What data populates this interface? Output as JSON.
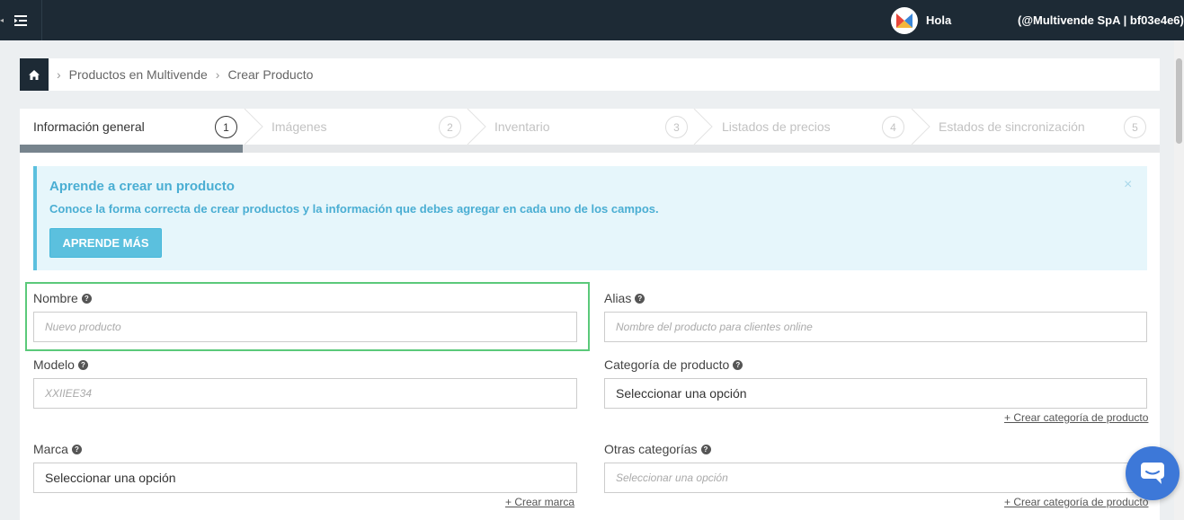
{
  "topbar": {
    "greeting": "Hola",
    "account": "(@Multivende SpA | bf03e4e6)"
  },
  "breadcrumb": {
    "items": [
      "Productos en Multivende",
      "Crear Producto"
    ]
  },
  "steps": [
    {
      "label": "Información general",
      "number": "1"
    },
    {
      "label": "Imágenes",
      "number": "2"
    },
    {
      "label": "Inventario",
      "number": "3"
    },
    {
      "label": "Listados de precios",
      "number": "4"
    },
    {
      "label": "Estados de sincronización",
      "number": "5"
    }
  ],
  "alert": {
    "title": "Aprende a crear un producto",
    "text": "Conoce la forma correcta de crear productos y la información que debes agregar en cada uno de los campos.",
    "button": "APRENDE MÁS",
    "close": "×"
  },
  "form": {
    "nombre": {
      "label": "Nombre",
      "placeholder": "Nuevo producto"
    },
    "alias": {
      "label": "Alias",
      "placeholder": "Nombre del producto para clientes online"
    },
    "modelo": {
      "label": "Modelo",
      "placeholder": "XXIIEE34"
    },
    "categoria": {
      "label": "Categoría de producto",
      "value": "Seleccionar una opción",
      "link": "+ Crear categoría de producto"
    },
    "marca": {
      "label": "Marca",
      "value": "Seleccionar una opción",
      "link": "+ Crear marca"
    },
    "otras": {
      "label": "Otras categorías",
      "placeholder": "Seleccionar una opción",
      "link": "+ Crear categoría de producto"
    }
  },
  "help_glyph": "?"
}
